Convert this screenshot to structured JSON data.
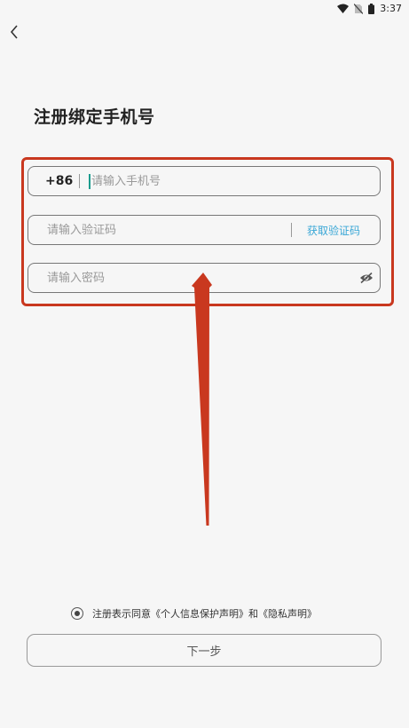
{
  "status_bar": {
    "time": "3:37",
    "icons": [
      "wifi-icon",
      "no-sim-icon",
      "battery-icon"
    ]
  },
  "header": {
    "back_icon": "chevron-left-icon",
    "title": "注册绑定手机号"
  },
  "form": {
    "phone": {
      "country_code": "+86",
      "placeholder": "请输入手机号",
      "value": ""
    },
    "code": {
      "placeholder": "请输入验证码",
      "value": "",
      "get_code_label": "获取验证码"
    },
    "password": {
      "placeholder": "请输入密码",
      "value": "",
      "toggle_icon": "eye-hidden-icon"
    }
  },
  "agreement": {
    "checked": true,
    "prefix": "注册表示同意",
    "privacy_protection_link": "《个人信息保护声明》",
    "and": "和",
    "privacy_statement_link": "《隐私声明》"
  },
  "footer": {
    "next_label": "下一步"
  },
  "colors": {
    "background": "#f6f6f6",
    "accent_link": "#3aa7d6",
    "annotation_red": "#c9381f",
    "caret": "#1b9c8e"
  }
}
